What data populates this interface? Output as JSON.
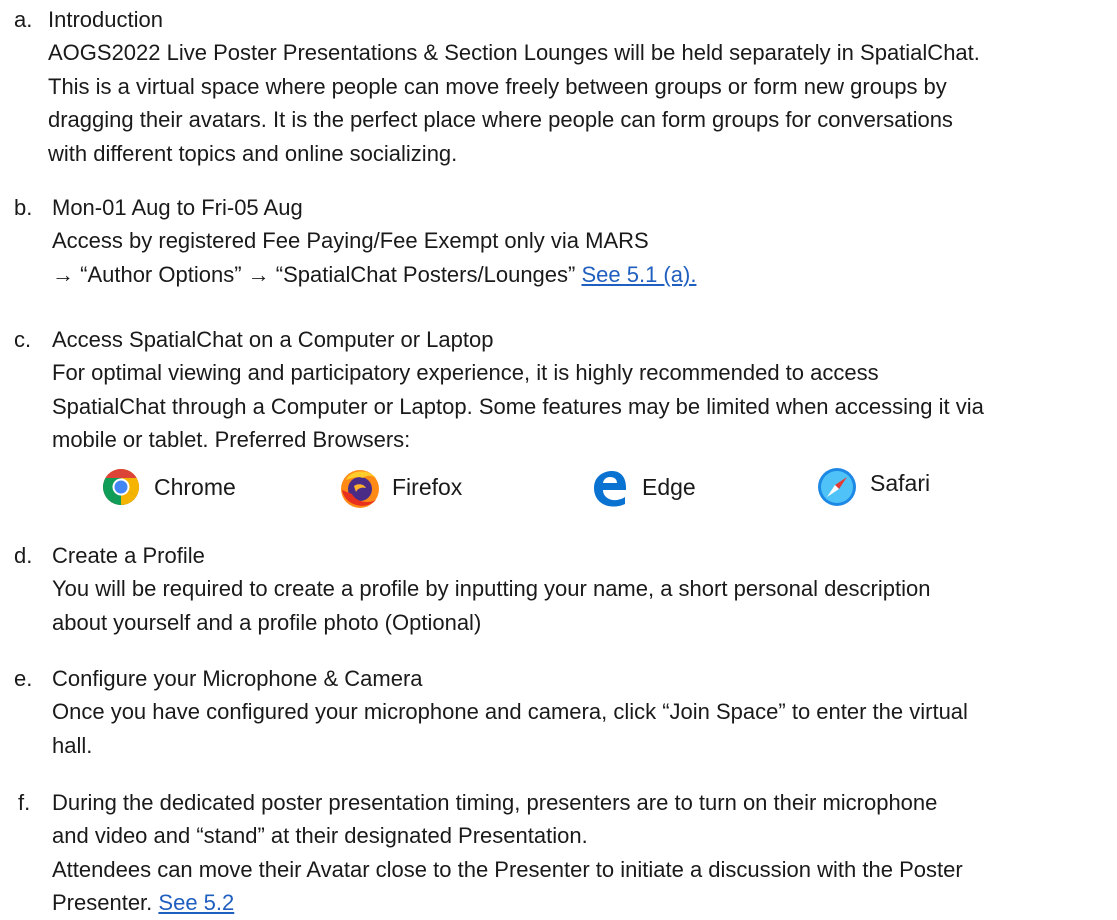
{
  "items": [
    {
      "marker": "a.",
      "heading": "Introduction",
      "lines": [
        "AOGS2022 Live Poster Presentations & Section Lounges will be held separately in SpatialChat.",
        "This is a virtual space where people can move freely between groups or form new groups by",
        "dragging their avatars. It is the perfect place where people can form groups for conversations",
        "with different topics and online socializing."
      ]
    },
    {
      "marker": "b.",
      "heading": "Mon-01 Aug to Fri-05 Aug",
      "line1": "Access by registered Fee Paying/Fee Exempt only via MARS",
      "line2_text": "→ “Author Options” → “SpatialChat Posters/Lounges”",
      "line2_link": "See 5.1 (a)."
    },
    {
      "marker": "c.",
      "heading": "Access SpatialChat on a Computer or Laptop",
      "lines": [
        "For optimal viewing and participatory experience, it is highly recommended to access",
        "SpatialChat through a Computer or Laptop. Some features may be limited when accessing it via",
        "mobile or tablet. Preferred Browsers:"
      ],
      "browsers": [
        {
          "name": "Chrome",
          "icon": "chrome-icon"
        },
        {
          "name": "Firefox",
          "icon": "firefox-icon"
        },
        {
          "name": "Edge",
          "icon": "edge-icon"
        },
        {
          "name": "Safari",
          "icon": "safari-icon"
        }
      ]
    },
    {
      "marker": "d.",
      "heading": "Create a Profile",
      "lines": [
        "You will be required to create a profile by inputting your name, a short personal description",
        "about yourself and a profile photo (Optional)"
      ]
    },
    {
      "marker": "e.",
      "heading": "Configure your Microphone & Camera",
      "lines": [
        "Once you have configured your microphone and camera, click “Join Space” to enter the virtual",
        "hall."
      ]
    },
    {
      "marker": "f.",
      "lines": [
        "During the dedicated poster presentation timing, presenters are to turn on their microphone",
        "and video and “stand” at their designated Presentation.",
        "Attendees can move their Avatar close to the Presenter to initiate a discussion with the Poster"
      ],
      "last_text": "Presenter.",
      "last_link": "See 5.2"
    }
  ],
  "colors": {
    "text": "#1a1a1a",
    "link": "#1f5fbf"
  }
}
